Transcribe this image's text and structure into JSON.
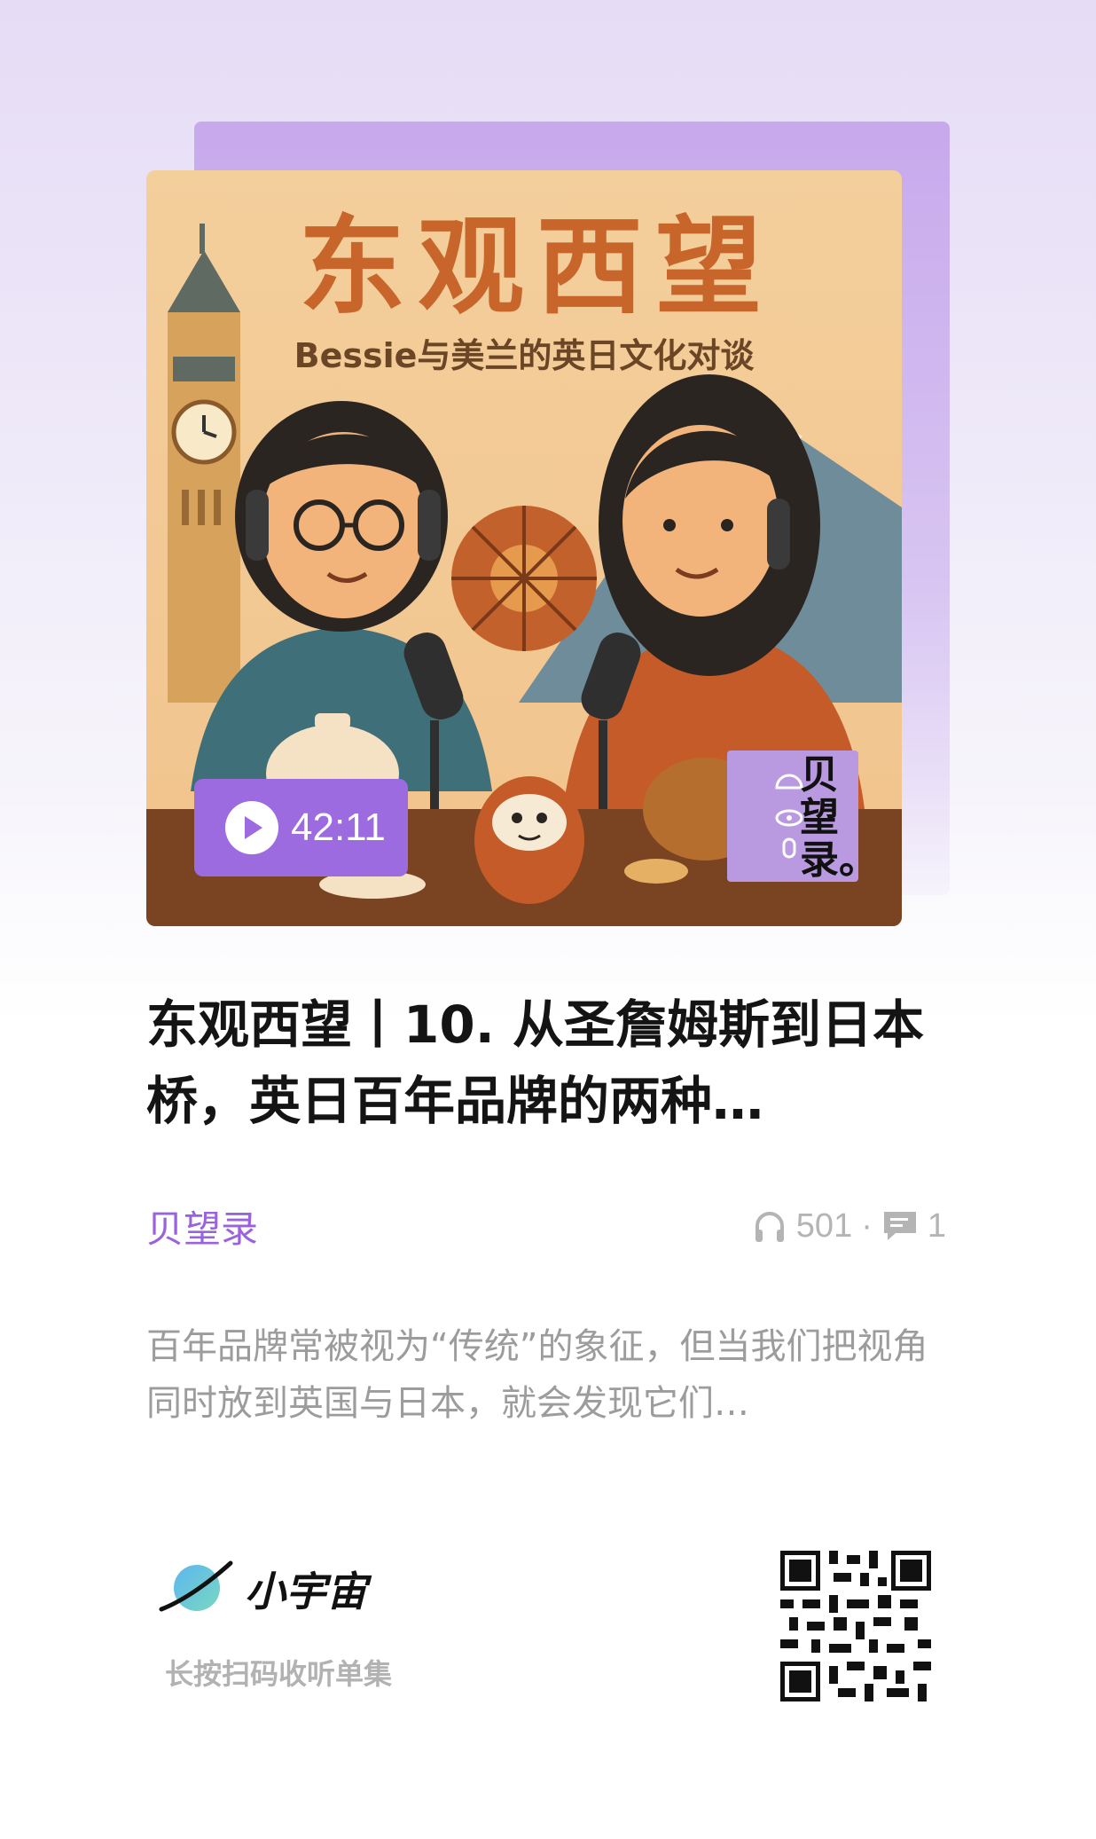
{
  "cover": {
    "title": "东观西望",
    "subtitle": "Bessie与美兰的英日文化对谈",
    "badge_text": "贝望录。",
    "duration": "42:11"
  },
  "episode": {
    "title": "东观西望丨10. 从圣詹姆斯到日本桥，英日百年品牌的两种…",
    "podcast": "贝望录",
    "listens": "501",
    "separator": "·",
    "comments": "1",
    "description": "百年品牌常被视为“传统”的象征，但当我们把视角同时放到英国与日本，就会发现它们…"
  },
  "footer": {
    "brand": "小宇宙",
    "hint": "长按扫码收听单集"
  },
  "icons": [
    "play-icon",
    "headphones-icon",
    "comment-icon",
    "planet-logo-icon",
    "qr-code"
  ],
  "colors": {
    "accent": "#9a62dc",
    "pill": "#9c6be0",
    "cover_title": "#c7652a"
  }
}
